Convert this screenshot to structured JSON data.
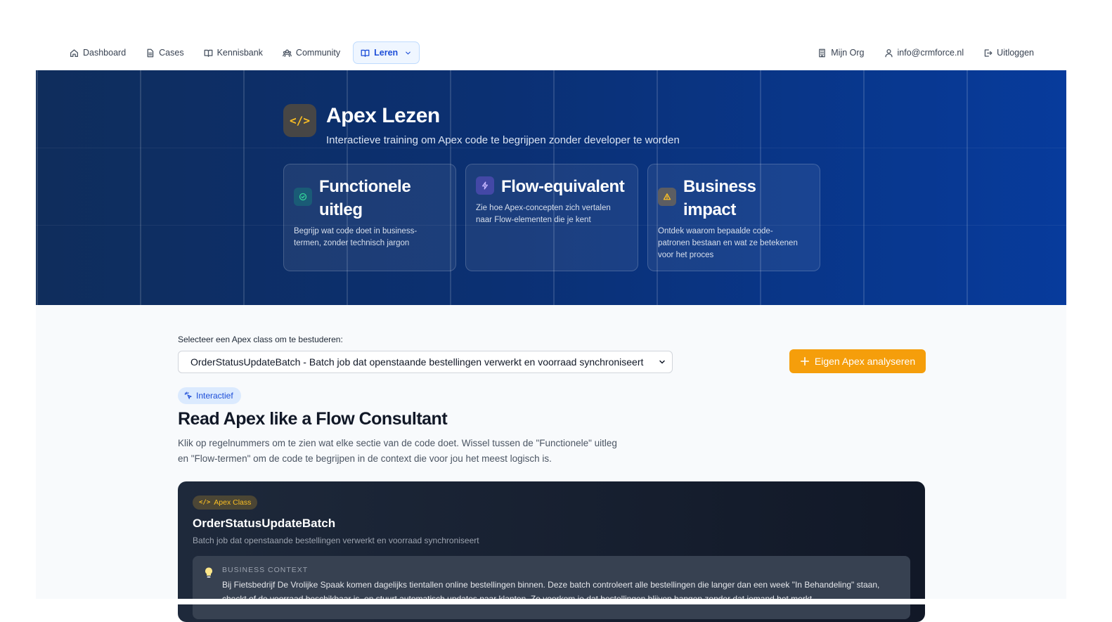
{
  "nav": {
    "left": [
      {
        "label": "Dashboard",
        "icon": "home-icon"
      },
      {
        "label": "Cases",
        "icon": "file-icon"
      },
      {
        "label": "Kennisbank",
        "icon": "book-icon"
      },
      {
        "label": "Community",
        "icon": "users-icon"
      },
      {
        "label": "Leren",
        "icon": "book-open-icon",
        "active": true
      }
    ],
    "right": [
      {
        "label": "Mijn Org",
        "icon": "building-icon"
      },
      {
        "label": "info@crmforce.nl",
        "icon": "user-icon"
      },
      {
        "label": "Uitloggen",
        "icon": "logout-icon"
      }
    ]
  },
  "hero": {
    "icon_glyph": "</>",
    "title": "Apex Lezen",
    "subtitle": "Interactieve training om Apex code te begrijpen zonder developer te worden",
    "cards": [
      {
        "title_l1": "Functionele",
        "title_l2": "uitleg",
        "desc_l1": "Begrijp wat code doet in business-",
        "desc_l2": "termen, zonder technisch jargon",
        "desc_l3": "",
        "color": "#10b981"
      },
      {
        "title_l1": "Flow-equivalent",
        "title_l2": "",
        "desc_l1": "Zie hoe Apex-concepten zich vertalen",
        "desc_l2": "naar Flow-elementen die je kent",
        "desc_l3": "",
        "color": "#8b5cf6"
      },
      {
        "title_l1": "Business",
        "title_l2": "impact",
        "desc_l1": "Ontdek waarom bepaalde code-",
        "desc_l2": "patronen bestaan en wat ze betekenen",
        "desc_l3": "voor het proces",
        "color": "#f59e0b"
      }
    ]
  },
  "main": {
    "select_label": "Selecteer een Apex class om te bestuderen:",
    "select_value": "OrderStatusUpdateBatch - Batch job dat openstaande bestellingen verwerkt en voorraad synchroniseert",
    "analyze_button": "Eigen Apex analyseren",
    "badge": "Interactief",
    "heading": "Read Apex like a Flow Consultant",
    "intro_l1": "Klik op regelnummers om te zien wat elke sectie van de code doet. Wissel tussen de \"Functionele\" uitleg",
    "intro_l2": "en \"Flow-termen\" om de code te begrijpen in de context die voor jou het meest logisch is."
  },
  "code_panel": {
    "badge": "Apex Class",
    "title": "OrderStatusUpdateBatch",
    "subtitle": "Batch job dat openstaande bestellingen verwerkt en voorraad synchroniseert",
    "context_label": "BUSINESS CONTEXT",
    "context_l1": "Bij Fietsbedrijf De Vrolijke Spaak komen dagelijks tientallen online bestellingen binnen. Deze batch controleert alle bestellingen die langer dan een week \"In Behandeling\" staan,",
    "context_l2": "checkt of de voorraad beschikbaar is, en stuurt automatisch updates naar klanten. Zo voorkom je dat bestellingen blijven hangen zonder dat iemand het merkt."
  },
  "colors": {
    "accent": "#1d4ed8",
    "primary_button": "#f59e0b",
    "hero_start": "#0f2d5c",
    "hero_end": "#073b9c"
  }
}
